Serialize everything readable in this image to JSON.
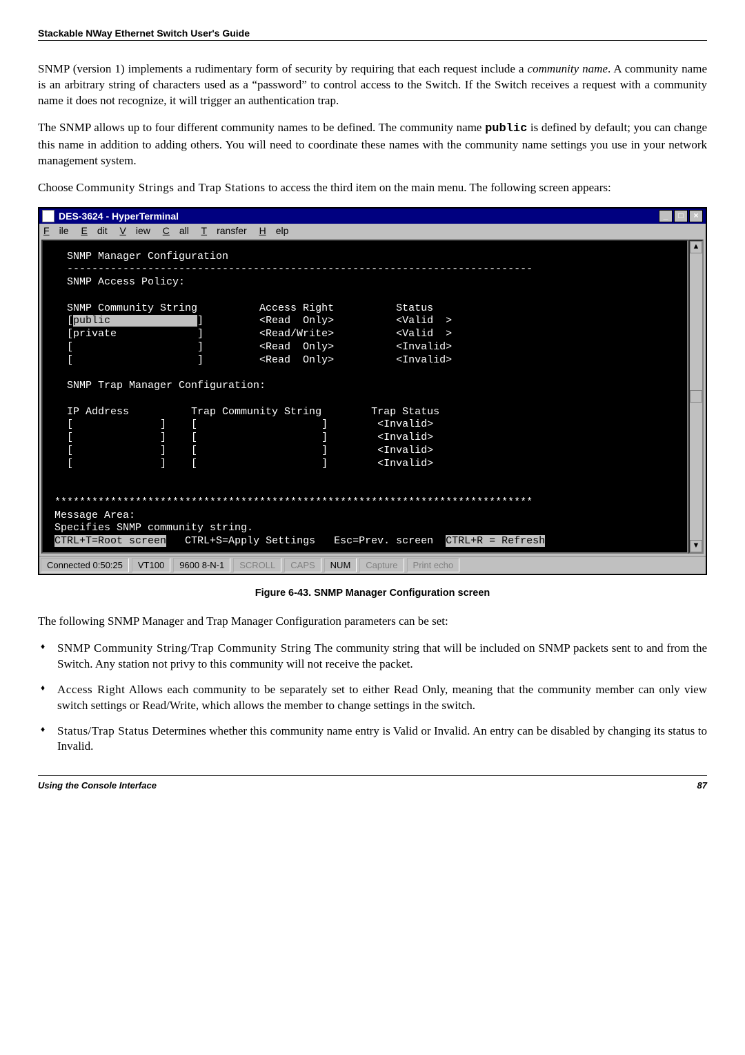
{
  "header": {
    "guide_title": "Stackable NWay Ethernet Switch User's Guide"
  },
  "para1_a": "SNMP (version 1) implements a rudimentary form of security by requiring that each request include a ",
  "para1_b": "community name",
  "para1_c": ". A community name is an arbitrary string of characters used as a “password” to control access to the Switch. If the Switch receives a request with a community name it does not recognize, it will trigger an authentication trap.",
  "para2_a": "The SNMP allows up to four different community names to be defined. The community name ",
  "para2_b": "public",
  "para2_c": " is defined by default; you can change this name in addition to adding others. You will need to coordinate these names with the community name settings you use in your network management system.",
  "para3_a": "Choose ",
  "para3_b": "Community Strings and Trap Stations",
  "para3_c": " to access the third item on the main menu. The following screen appears:",
  "hyperterm": {
    "title": "DES-3624 - HyperTerminal",
    "menus": {
      "file": "File",
      "edit": "Edit",
      "view": "View",
      "call": "Call",
      "transfer": "Transfer",
      "help": "Help"
    },
    "winbtns": {
      "min": "_",
      "max": "□",
      "close": "×"
    },
    "term": {
      "l1": "   SNMP Manager Configuration",
      "l2": "   ---------------------------------------------------------------------------",
      "l3": "   SNMP Access Policy:",
      "l4": "",
      "l5": "   SNMP Community String          Access Right          Status",
      "l6a": "   [",
      "l6b": "public              ",
      "l6c": "]         <Read  Only>          <Valid  >",
      "l7": "   [private             ]         <Read/Write>          <Valid  >",
      "l8": "   [                    ]         <Read  Only>          <Invalid>",
      "l9": "   [                    ]         <Read  Only>          <Invalid>",
      "l10": "",
      "l11": "   SNMP Trap Manager Configuration:",
      "l12": "",
      "l13": "   IP Address          Trap Community String        Trap Status",
      "l14": "   [              ]    [                    ]        <Invalid>",
      "l15": "   [              ]    [                    ]        <Invalid>",
      "l16": "   [              ]    [                    ]        <Invalid>",
      "l17": "   [              ]    [                    ]        <Invalid>",
      "l18": "",
      "l19": "",
      "l20": " *****************************************************************************",
      "l21": " Message Area:",
      "l22": " Specifies SNMP community string.",
      "l23a": " ",
      "l23b": "CTRL+T=Root screen",
      "l23c": "   CTRL+S=Apply Settings   Esc=Prev. screen  ",
      "l23d": "CTRL+R = Refresh"
    },
    "status": {
      "conn": "Connected 0:50:25",
      "emul": "VT100",
      "port": "9600 8-N-1",
      "scroll": "SCROLL",
      "caps": "CAPS",
      "num": "NUM",
      "capture": "Capture",
      "echo": "Print echo"
    }
  },
  "fig_caption": "Figure 6-43.  SNMP Manager Configuration screen",
  "para4": "The following SNMP Manager and Trap Manager Configuration parameters can be set:",
  "bullets": {
    "b1_a": "SNMP Community String/Trap Community String",
    "b1_b": "  The community string that will be included on SNMP packets sent to and from the Switch. Any station not privy to this community will not receive the packet.",
    "b2_a": "Access Right",
    "b2_b": "  Allows each community to be separately set to either ",
    "b2_c": "Read Only,",
    "b2_d": " meaning that the community member can only view switch settings or ",
    "b2_e": "Read/Write,",
    "b2_f": " which allows the member to change settings in the switch.",
    "b3_a": "Status/Trap Status",
    "b3_b": "  Determines whether this community name entry is ",
    "b3_c": "Valid",
    "b3_d": " or ",
    "b3_e": "Invalid",
    "b3_f": ". An entry can be disabled by changing its status to ",
    "b3_g": "Invalid",
    "b3_h": "."
  },
  "footer": {
    "left": "Using the Console Interface",
    "right": "87"
  }
}
